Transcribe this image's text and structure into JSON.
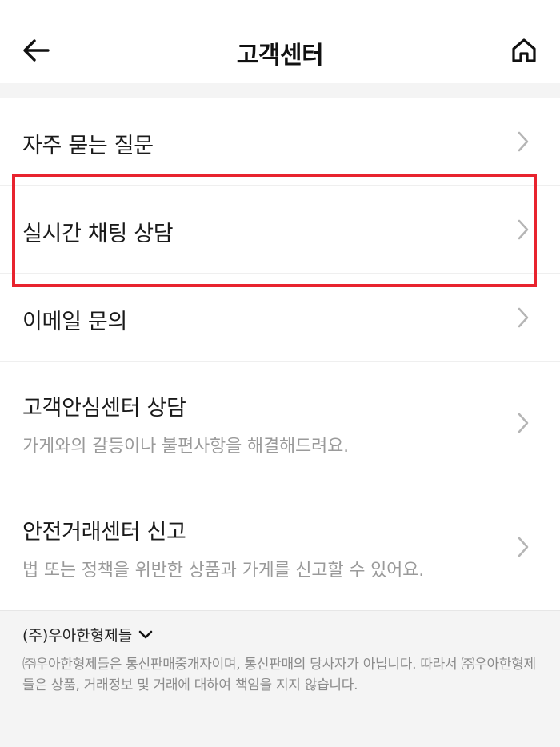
{
  "header": {
    "title": "고객센터",
    "back_icon": "arrow-left-icon",
    "home_icon": "home-icon"
  },
  "menu": {
    "items": [
      {
        "label": "자주 묻는 질문",
        "description": ""
      },
      {
        "label": "실시간 채팅 상담",
        "description": ""
      },
      {
        "label": "이메일 문의",
        "description": ""
      },
      {
        "label": "고객안심센터 상담",
        "description": "가게와의 갈등이나 불편사항을 해결해드려요."
      },
      {
        "label": "안전거래센터 신고",
        "description": "법 또는 정책을 위반한 상품과 가게를 신고할 수 있어요."
      }
    ],
    "highlighted_index": 1,
    "highlight_color": "#e8232e"
  },
  "footer": {
    "company_name": "(주)우아한형제들",
    "disclaimer": "㈜우아한형제들은 통신판매중개자이며, 통신판매의 당사자가 아닙니다. 따라서 ㈜우아한형제들은 상품, 거래정보 및 거래에 대하여 책임을 지지 않습니다."
  },
  "colors": {
    "background": "#ffffff",
    "section_gap": "#f4f4f4",
    "text_primary": "#1a1a1a",
    "text_secondary": "#9a9a9a",
    "chevron": "#b5b5b5"
  }
}
